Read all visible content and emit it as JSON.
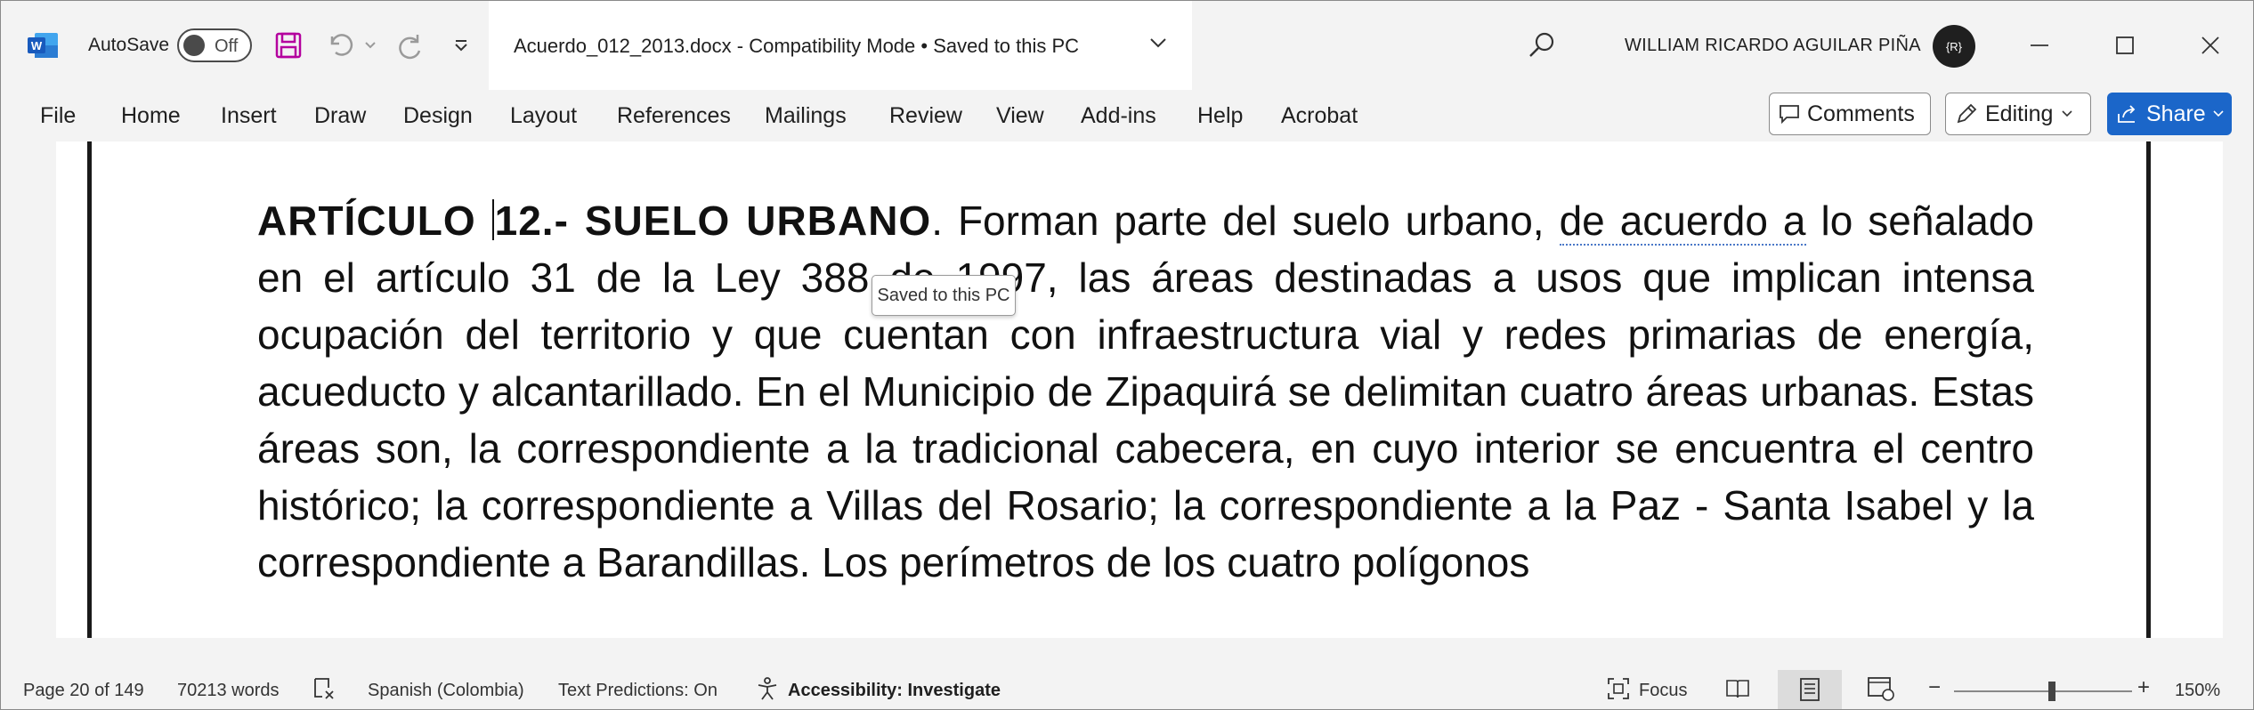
{
  "titlebar": {
    "autosave_label": "AutoSave",
    "autosave_state": "Off",
    "doc_title": "Acuerdo_012_2013.docx  -  Compatibility Mode • Saved to this PC",
    "user_name": "WILLIAM RICARDO AGUILAR PIÑA",
    "avatar_initials": "{R}"
  },
  "ribbon": {
    "tabs": [
      "File",
      "Home",
      "Insert",
      "Draw",
      "Design",
      "Layout",
      "References",
      "Mailings",
      "Review",
      "View",
      "Add-ins",
      "Help",
      "Acrobat"
    ],
    "comments_label": "Comments",
    "editing_label": "Editing",
    "share_label": "Share"
  },
  "document": {
    "heading": "ARTÍCULO",
    "heading2": "12.- SUELO URBANO",
    "text_a": ". Forman parte del suelo urbano, ",
    "text_dotted": "de acuerdo a",
    "text_b": " lo señalado en el artículo 31 de la Ley 388 de 1997, las áreas destinadas a usos que implican intensa ocupación del territorio y que cuentan con infraestructura vial y redes primarias de energía, acueducto y alcantarillado. En el Municipio de Zipaquirá se delimitan cuatro áreas urbanas. Estas áreas son, la correspondiente a la tradicional cabecera, en cuyo interior se encuentra el centro histórico; la correspondiente a Villas del Rosario; la correspondiente a la Paz - Santa Isabel y la correspondiente a Barandillas. Los perímetros de los cuatro polígonos",
    "tooltip": "Saved to this PC"
  },
  "statusbar": {
    "page": "Page 20 of 149",
    "words": "70213 words",
    "language": "Spanish (Colombia)",
    "predictions": "Text Predictions: On",
    "accessibility": "Accessibility: Investigate",
    "focus": "Focus",
    "zoom": "150%",
    "zoom_minus": "−",
    "zoom_plus": "+"
  },
  "colors": {
    "accent": "#1b66c9",
    "word_blue": "#185abd",
    "save_icon": "#b4009e"
  }
}
